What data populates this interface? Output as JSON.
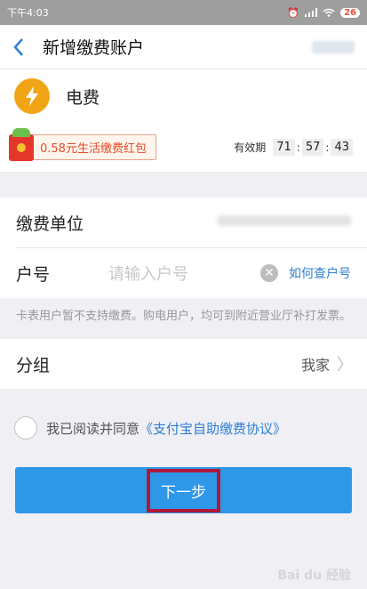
{
  "status": {
    "time": "下午4:03",
    "battery": "26"
  },
  "nav": {
    "back_icon": "chevron-left-icon",
    "title": "新增缴费账户"
  },
  "biz": {
    "icon": "lightning-icon",
    "name": "电费",
    "color": "#f2a417"
  },
  "promo": {
    "label": "0.58元生活缴费红包",
    "validity_label": "有效期",
    "hours": "71",
    "minutes": "57",
    "seconds": "43",
    "sep": ":"
  },
  "form": {
    "unit_label": "缴费单位",
    "account_label": "户号",
    "account_placeholder": "请输入户号",
    "help_link": "如何查户号"
  },
  "notice": "卡表用户暂不支持缴费。购电用户，均可到附近营业厅补打发票。",
  "group": {
    "label": "分组",
    "value": "我家"
  },
  "agreement": {
    "text": "我已阅读并同意",
    "link": "《支付宝自助缴费协议》"
  },
  "next": {
    "label": "下一步",
    "color": "#2f97e8"
  },
  "watermark": "Bai du 经验"
}
